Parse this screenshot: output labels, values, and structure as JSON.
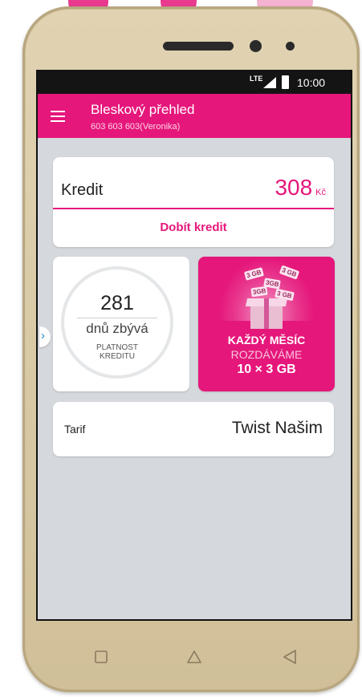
{
  "status_bar": {
    "network": "LTE",
    "time": "10:00"
  },
  "app_bar": {
    "title": "Bleskový přehled",
    "subtitle": "603 603 603(Veronika)"
  },
  "credit": {
    "label": "Kredit",
    "amount": "308",
    "currency": "Kč",
    "topup_label": "Dobít kredit"
  },
  "validity": {
    "days": "281",
    "days_left_label": "dnů zbývá",
    "note": "PLATNOST KREDITU"
  },
  "promo": {
    "line1": "KAŽDÝ MĚSÍC",
    "line2": "ROZDÁVÁME",
    "line3": "10 × 3 GB",
    "tiles": [
      "3 GB",
      "3GB",
      "3 GB",
      "3GB",
      "3 GB"
    ]
  },
  "tariff": {
    "label": "Tarif",
    "value": "Twist Našim"
  },
  "nav": {
    "recent_icon": "square-icon",
    "home_icon": "triangle-up-icon",
    "back_icon": "triangle-left-icon"
  },
  "colors": {
    "accent": "#e5177b",
    "screen_bg": "#d5d8dc",
    "phone_gold": "#d7c7a3"
  }
}
